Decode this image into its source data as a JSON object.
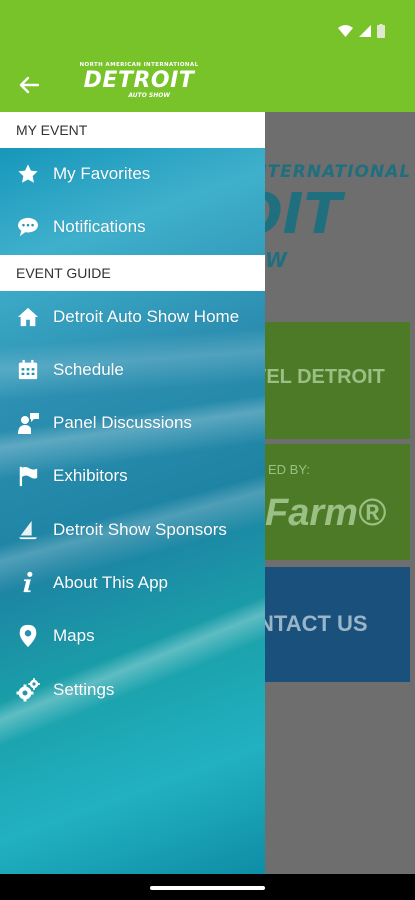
{
  "appbar": {
    "logo_top": "NORTH AMERICAN INTERNATIONAL",
    "logo_main": "DETROIT",
    "logo_sub": "AUTO SHOW"
  },
  "background": {
    "logo_line1": "INTERNATIONAL",
    "logo_line2": "OIT",
    "logo_line3": "W",
    "tile1": "VEL DETROIT",
    "tile2a": "ED BY:",
    "tile2b": "Farm®",
    "tile3": "NTACT US"
  },
  "drawer": {
    "section_my_event": "MY EVENT",
    "section_event_guide": "EVENT GUIDE",
    "items": [
      {
        "label": "My Favorites",
        "icon": "star-icon"
      },
      {
        "label": "Notifications",
        "icon": "chat-bubble-icon"
      },
      {
        "label": "Detroit Auto Show Home",
        "icon": "home-icon"
      },
      {
        "label": "Schedule",
        "icon": "calendar-icon"
      },
      {
        "label": "Panel Discussions",
        "icon": "speaker-icon"
      },
      {
        "label": "Exhibitors",
        "icon": "flag-icon"
      },
      {
        "label": "Detroit Show Sponsors",
        "icon": "sail-icon"
      },
      {
        "label": "About This App",
        "icon": "info-icon"
      },
      {
        "label": "Maps",
        "icon": "map-pin-icon"
      },
      {
        "label": "Settings",
        "icon": "gears-icon"
      }
    ]
  },
  "colors": {
    "accent": "#78c22a",
    "drawer_blue": "#1d83a3",
    "header_white": "#ffffff"
  }
}
